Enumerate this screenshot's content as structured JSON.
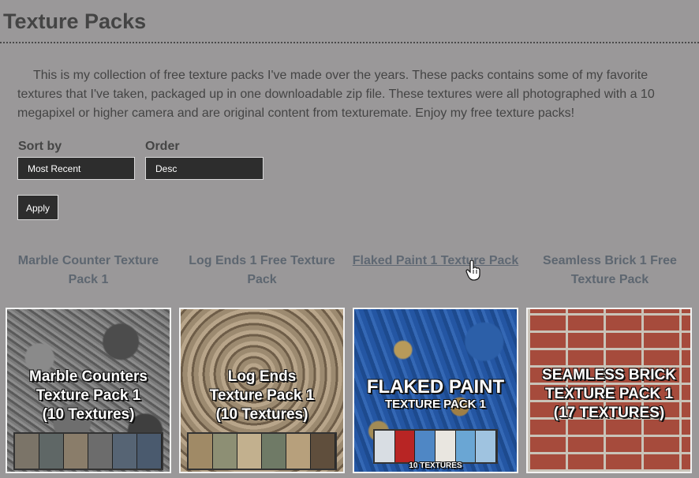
{
  "page": {
    "title": "Texture Packs",
    "intro": "This is my collection of free texture packs I've made over the years. These packs contains some of my favorite textures that I've taken, packaged up in one downloadable zip file. These textures were all photographed with a 10 megapixel or higher camera and are original content from texturemate. Enjoy my free texture packs!"
  },
  "controls": {
    "sort_label": "Sort by",
    "sort_value": "Most Recent",
    "order_label": "Order",
    "order_value": "Desc",
    "apply_label": "Apply"
  },
  "packs": [
    {
      "title": "Marble Counter Texture Pack 1",
      "thumb_lines": [
        "Marble Counters",
        "Texture Pack 1",
        "(10 Textures)"
      ]
    },
    {
      "title": "Log Ends 1 Free Texture Pack",
      "thumb_lines": [
        "Log Ends",
        "Texture Pack 1",
        "(10 Textures)"
      ]
    },
    {
      "title": "Flaked Paint 1 Texture Pack",
      "thumb_lines": [
        "FLAKED PAINT",
        "TEXTURE PACK 1"
      ],
      "thumb_footer": "10 TEXTURES"
    },
    {
      "title": "Seamless Brick 1 Free Texture Pack",
      "thumb_lines": [
        "SEAMLESS BRICK",
        "TEXTURE PACK 1",
        "(17 TEXTURES)"
      ]
    }
  ],
  "colors": {
    "background": "#9a9899",
    "control_bg": "#2d2d2d",
    "link_text": "#5d6670"
  },
  "icons": {
    "cursor": "hand-pointer-icon"
  }
}
